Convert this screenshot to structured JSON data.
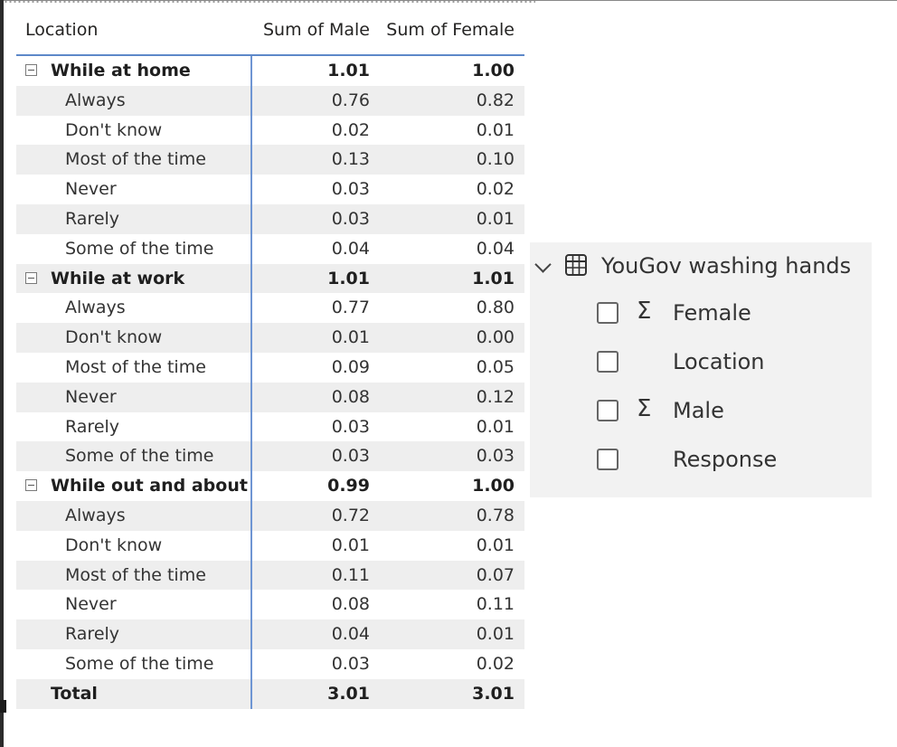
{
  "matrix": {
    "headers": {
      "location": "Location",
      "male": "Sum of Male",
      "female": "Sum of Female"
    },
    "groups": [
      {
        "label": "While at home",
        "male": "1.01",
        "female": "1.00",
        "items": [
          {
            "label": "Always",
            "male": "0.76",
            "female": "0.82"
          },
          {
            "label": "Don't know",
            "male": "0.02",
            "female": "0.01"
          },
          {
            "label": "Most of the time",
            "male": "0.13",
            "female": "0.10"
          },
          {
            "label": "Never",
            "male": "0.03",
            "female": "0.02"
          },
          {
            "label": "Rarely",
            "male": "0.03",
            "female": "0.01"
          },
          {
            "label": "Some of the time",
            "male": "0.04",
            "female": "0.04"
          }
        ]
      },
      {
        "label": "While at work",
        "male": "1.01",
        "female": "1.01",
        "items": [
          {
            "label": "Always",
            "male": "0.77",
            "female": "0.80"
          },
          {
            "label": "Don't know",
            "male": "0.01",
            "female": "0.00"
          },
          {
            "label": "Most of the time",
            "male": "0.09",
            "female": "0.05"
          },
          {
            "label": "Never",
            "male": "0.08",
            "female": "0.12"
          },
          {
            "label": "Rarely",
            "male": "0.03",
            "female": "0.01"
          },
          {
            "label": "Some of the time",
            "male": "0.03",
            "female": "0.03"
          }
        ]
      },
      {
        "label": "While out and about",
        "male": "0.99",
        "female": "1.00",
        "items": [
          {
            "label": "Always",
            "male": "0.72",
            "female": "0.78"
          },
          {
            "label": "Don't know",
            "male": "0.01",
            "female": "0.01"
          },
          {
            "label": "Most of the time",
            "male": "0.11",
            "female": "0.07"
          },
          {
            "label": "Never",
            "male": "0.08",
            "female": "0.11"
          },
          {
            "label": "Rarely",
            "male": "0.04",
            "female": "0.01"
          },
          {
            "label": "Some of the time",
            "male": "0.03",
            "female": "0.02"
          }
        ]
      }
    ],
    "total": {
      "label": "Total",
      "male": "3.01",
      "female": "3.01"
    }
  },
  "field_list": {
    "table_name": "YouGov washing hands",
    "fields": [
      {
        "name": "Female",
        "aggregate": true,
        "checked": false
      },
      {
        "name": "Location",
        "aggregate": false,
        "checked": false
      },
      {
        "name": "Male",
        "aggregate": true,
        "checked": false
      },
      {
        "name": "Response",
        "aggregate": false,
        "checked": false
      }
    ],
    "sigma_symbol": "Σ"
  },
  "colors": {
    "accent_line": "#5d88c9",
    "row_band": "#eeeeee",
    "panel_bg": "#f2f2f2"
  }
}
